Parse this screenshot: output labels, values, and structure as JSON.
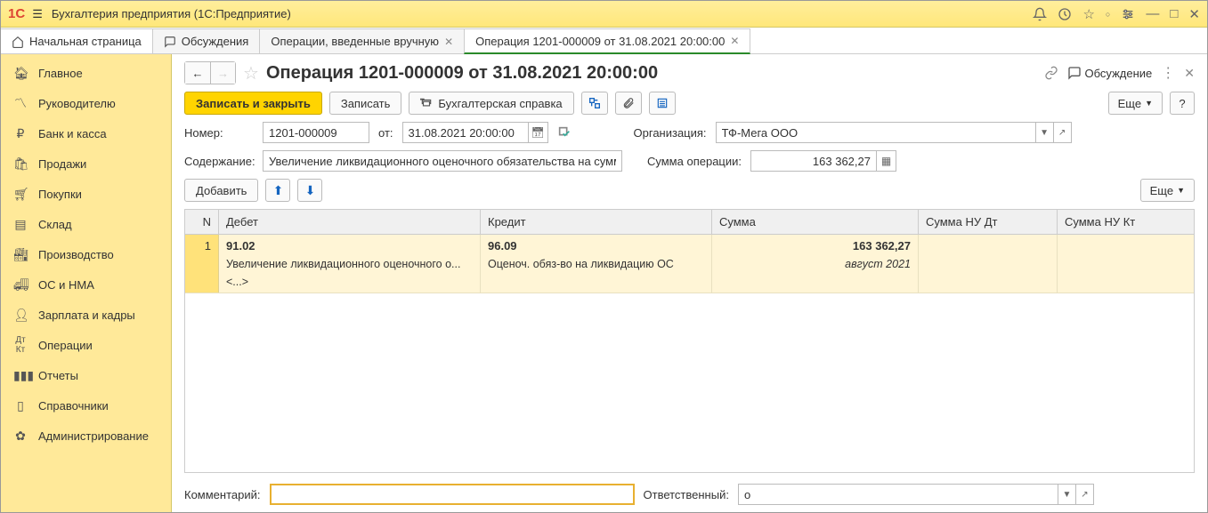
{
  "title": "Бухгалтерия предприятия  (1С:Предприятие)",
  "tabs": {
    "home": "Начальная страница",
    "t1": "Обсуждения",
    "t2": "Операции, введенные вручную",
    "t3": "Операция 1201-000009 от 31.08.2021 20:00:00"
  },
  "sidebar": [
    "Главное",
    "Руководителю",
    "Банк и касса",
    "Продажи",
    "Покупки",
    "Склад",
    "Производство",
    "ОС и НМА",
    "Зарплата и кадры",
    "Операции",
    "Отчеты",
    "Справочники",
    "Администрирование"
  ],
  "page": {
    "title": "Операция 1201-000009 от 31.08.2021 20:00:00",
    "discuss": "Обсуждение",
    "save_close": "Записать и закрыть",
    "save": "Записать",
    "report": "Бухгалтерская справка",
    "more": "Еще",
    "help": "?",
    "num_label": "Номер:",
    "num_value": "1201-000009",
    "from_label": "от:",
    "date_value": "31.08.2021 20:00:00",
    "org_label": "Организация:",
    "org_value": "ТФ-Мега ООО",
    "content_label": "Содержание:",
    "content_value": "Увеличение ликвидационного оценочного обязательства на сумму",
    "opsum_label": "Сумма операции:",
    "opsum_value": "163 362,27",
    "add": "Добавить",
    "cols": {
      "n": "N",
      "debit": "Дебет",
      "credit": "Кредит",
      "sum": "Сумма",
      "nudt": "Сумма НУ Дт",
      "nukt": "Сумма НУ Кт"
    },
    "row": {
      "n": "1",
      "debit_acct": "91.02",
      "debit_sub": "Увеличение ликвидационного оценочного о...",
      "debit_extra": "<...>",
      "credit_acct": "96.09",
      "credit_sub": "Оценоч. обяз-во на ликвидацию ОС",
      "sum": "163 362,27",
      "sum_sub": "август 2021"
    },
    "comment_label": "Комментарий:",
    "comment_value": "",
    "resp_label": "Ответственный:",
    "resp_value": "о"
  }
}
